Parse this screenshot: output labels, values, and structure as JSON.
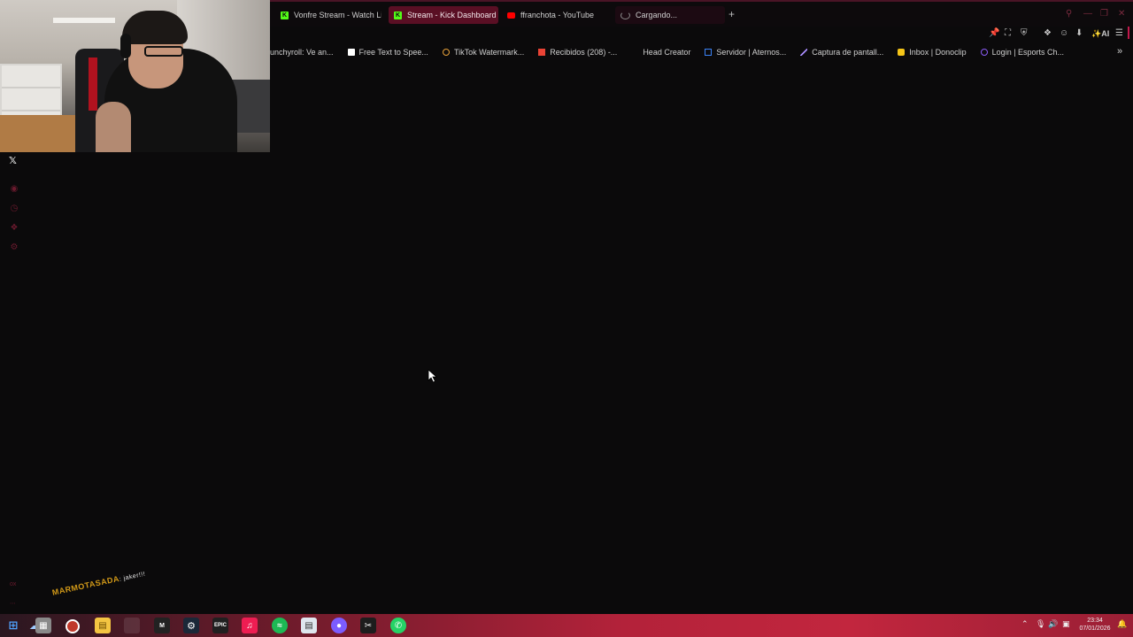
{
  "tabs": [
    {
      "label": "Vonfre Stream - Watch Li",
      "icon": "kick-icon"
    },
    {
      "label": "Stream - Kick Dashboard",
      "icon": "kick-icon",
      "active": true
    },
    {
      "label": "ffranchota - YouTube",
      "icon": "youtube-icon"
    },
    {
      "label": "Cargando...",
      "icon": "loading-spinner-icon"
    }
  ],
  "toolbar": {
    "ai_label": "AI"
  },
  "bookmarks": [
    {
      "label": "unchyroll: Ve an...",
      "color": "#f47521"
    },
    {
      "label": "Free Text to Spee...",
      "color": "#ffffff"
    },
    {
      "label": "TikTok Watermark...",
      "color": "#e8a23a"
    },
    {
      "label": "Recibidos (208) -...",
      "color": "#ea4335"
    },
    {
      "label": "Head Creator",
      "color": "#0b0a0b"
    },
    {
      "label": "Servidor | Aternos...",
      "color": "#3b82f6"
    },
    {
      "label": "Captura de pantall...",
      "color": "#a78bfa"
    },
    {
      "label": "Inbox | Donoclip",
      "color": "#f5c518"
    },
    {
      "label": "Login | Esports Ch...",
      "color": "#8b5cf6"
    }
  ],
  "overlay": {
    "name": "MARMOTASADA",
    "message": ": jaker!!!"
  },
  "sidebar": {
    "bottom_label": "ox"
  },
  "clock": {
    "time": "23:34",
    "date": "07/01/2026"
  },
  "colors": {
    "accent": "#c2184b",
    "kick": "#53fc18",
    "background": "#0b0a0b"
  }
}
